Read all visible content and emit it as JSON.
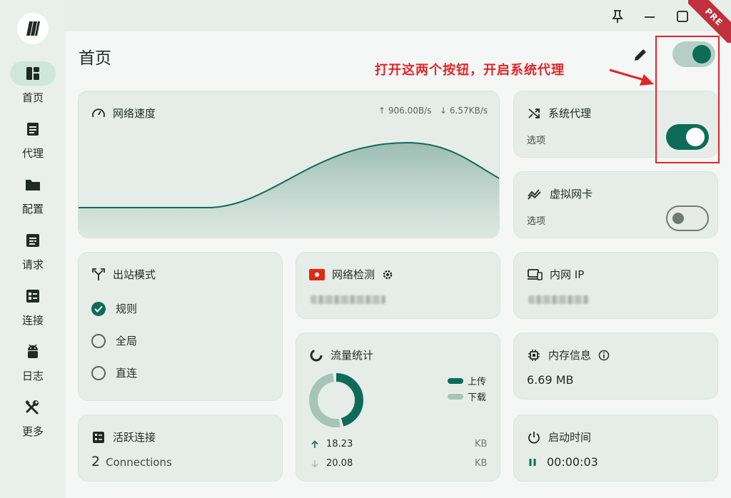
{
  "nav": {
    "items": [
      {
        "label": "首页",
        "icon": "dashboard-icon",
        "active": true
      },
      {
        "label": "代理",
        "icon": "list-icon"
      },
      {
        "label": "配置",
        "icon": "folder-icon"
      },
      {
        "label": "请求",
        "icon": "request-icon"
      },
      {
        "label": "连接",
        "icon": "connection-icon"
      },
      {
        "label": "日志",
        "icon": "android-icon"
      },
      {
        "label": "更多",
        "icon": "tools-icon"
      }
    ]
  },
  "ribbon": "PRE",
  "page": {
    "title": "首页"
  },
  "annotation": "打开这两个按钮，开启系统代理",
  "speed": {
    "title": "网络速度",
    "up": "↑ 906.00B/s",
    "down": "↓ 6.57KB/s"
  },
  "system_proxy": {
    "title": "系统代理",
    "sub": "选项"
  },
  "tun": {
    "title": "虚拟网卡",
    "sub": "选项"
  },
  "outbound": {
    "title": "出站模式",
    "options": [
      "规则",
      "全局",
      "直连"
    ],
    "selected": 0
  },
  "net_check": {
    "title": "网络检测"
  },
  "lan_ip": {
    "title": "内网 IP"
  },
  "traffic": {
    "title": "流量统计",
    "legend_up": "上传",
    "legend_down": "下载",
    "up_value": "18.23",
    "down_value": "20.08",
    "unit": "KB",
    "up_fraction": 0.476
  },
  "memory": {
    "title": "内存信息",
    "value": "6.69 MB"
  },
  "connections": {
    "title": "活跃连接",
    "count": "2",
    "label": "Connections"
  },
  "uptime": {
    "title": "启动时间",
    "value": "00:00:03"
  },
  "colors": {
    "accent": "#0e6b57",
    "accent_light": "#a7c3ba",
    "annotation": "#e0262a"
  }
}
